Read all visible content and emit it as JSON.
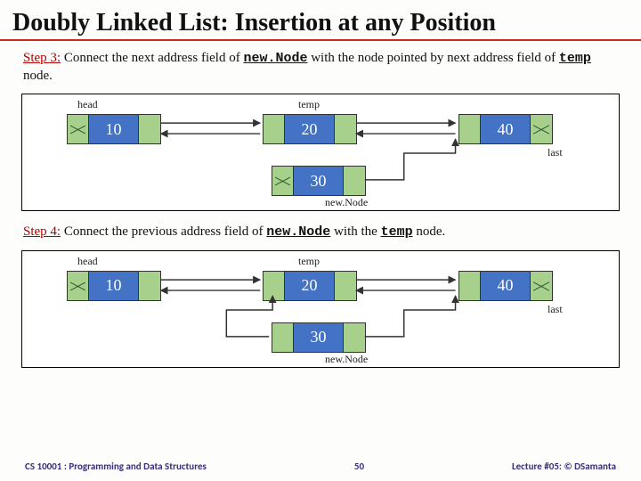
{
  "title": "Doubly Linked List: Insertion at any Position",
  "step3": {
    "label": "Step 3:",
    "pre": " Connect the next address field of ",
    "kw1": "new.Node",
    "mid": "  with the node pointed by next address field of ",
    "kw2": "temp",
    "post": " node."
  },
  "step4": {
    "label": "Step 4:",
    "pre": "  Connect the previous address field of ",
    "kw1": "new.Node",
    "mid": " with the ",
    "kw2": "temp",
    "post": " node."
  },
  "labels": {
    "head": "head",
    "temp": "temp",
    "last": "last",
    "newNode": "new.Node"
  },
  "nodes": {
    "n10": "10",
    "n20": "20",
    "n30": "30",
    "n40": "40"
  },
  "footer": {
    "left": "CS 10001 : Programming and Data Structures",
    "page": "50",
    "right": "Lecture #05: © DSamanta"
  }
}
